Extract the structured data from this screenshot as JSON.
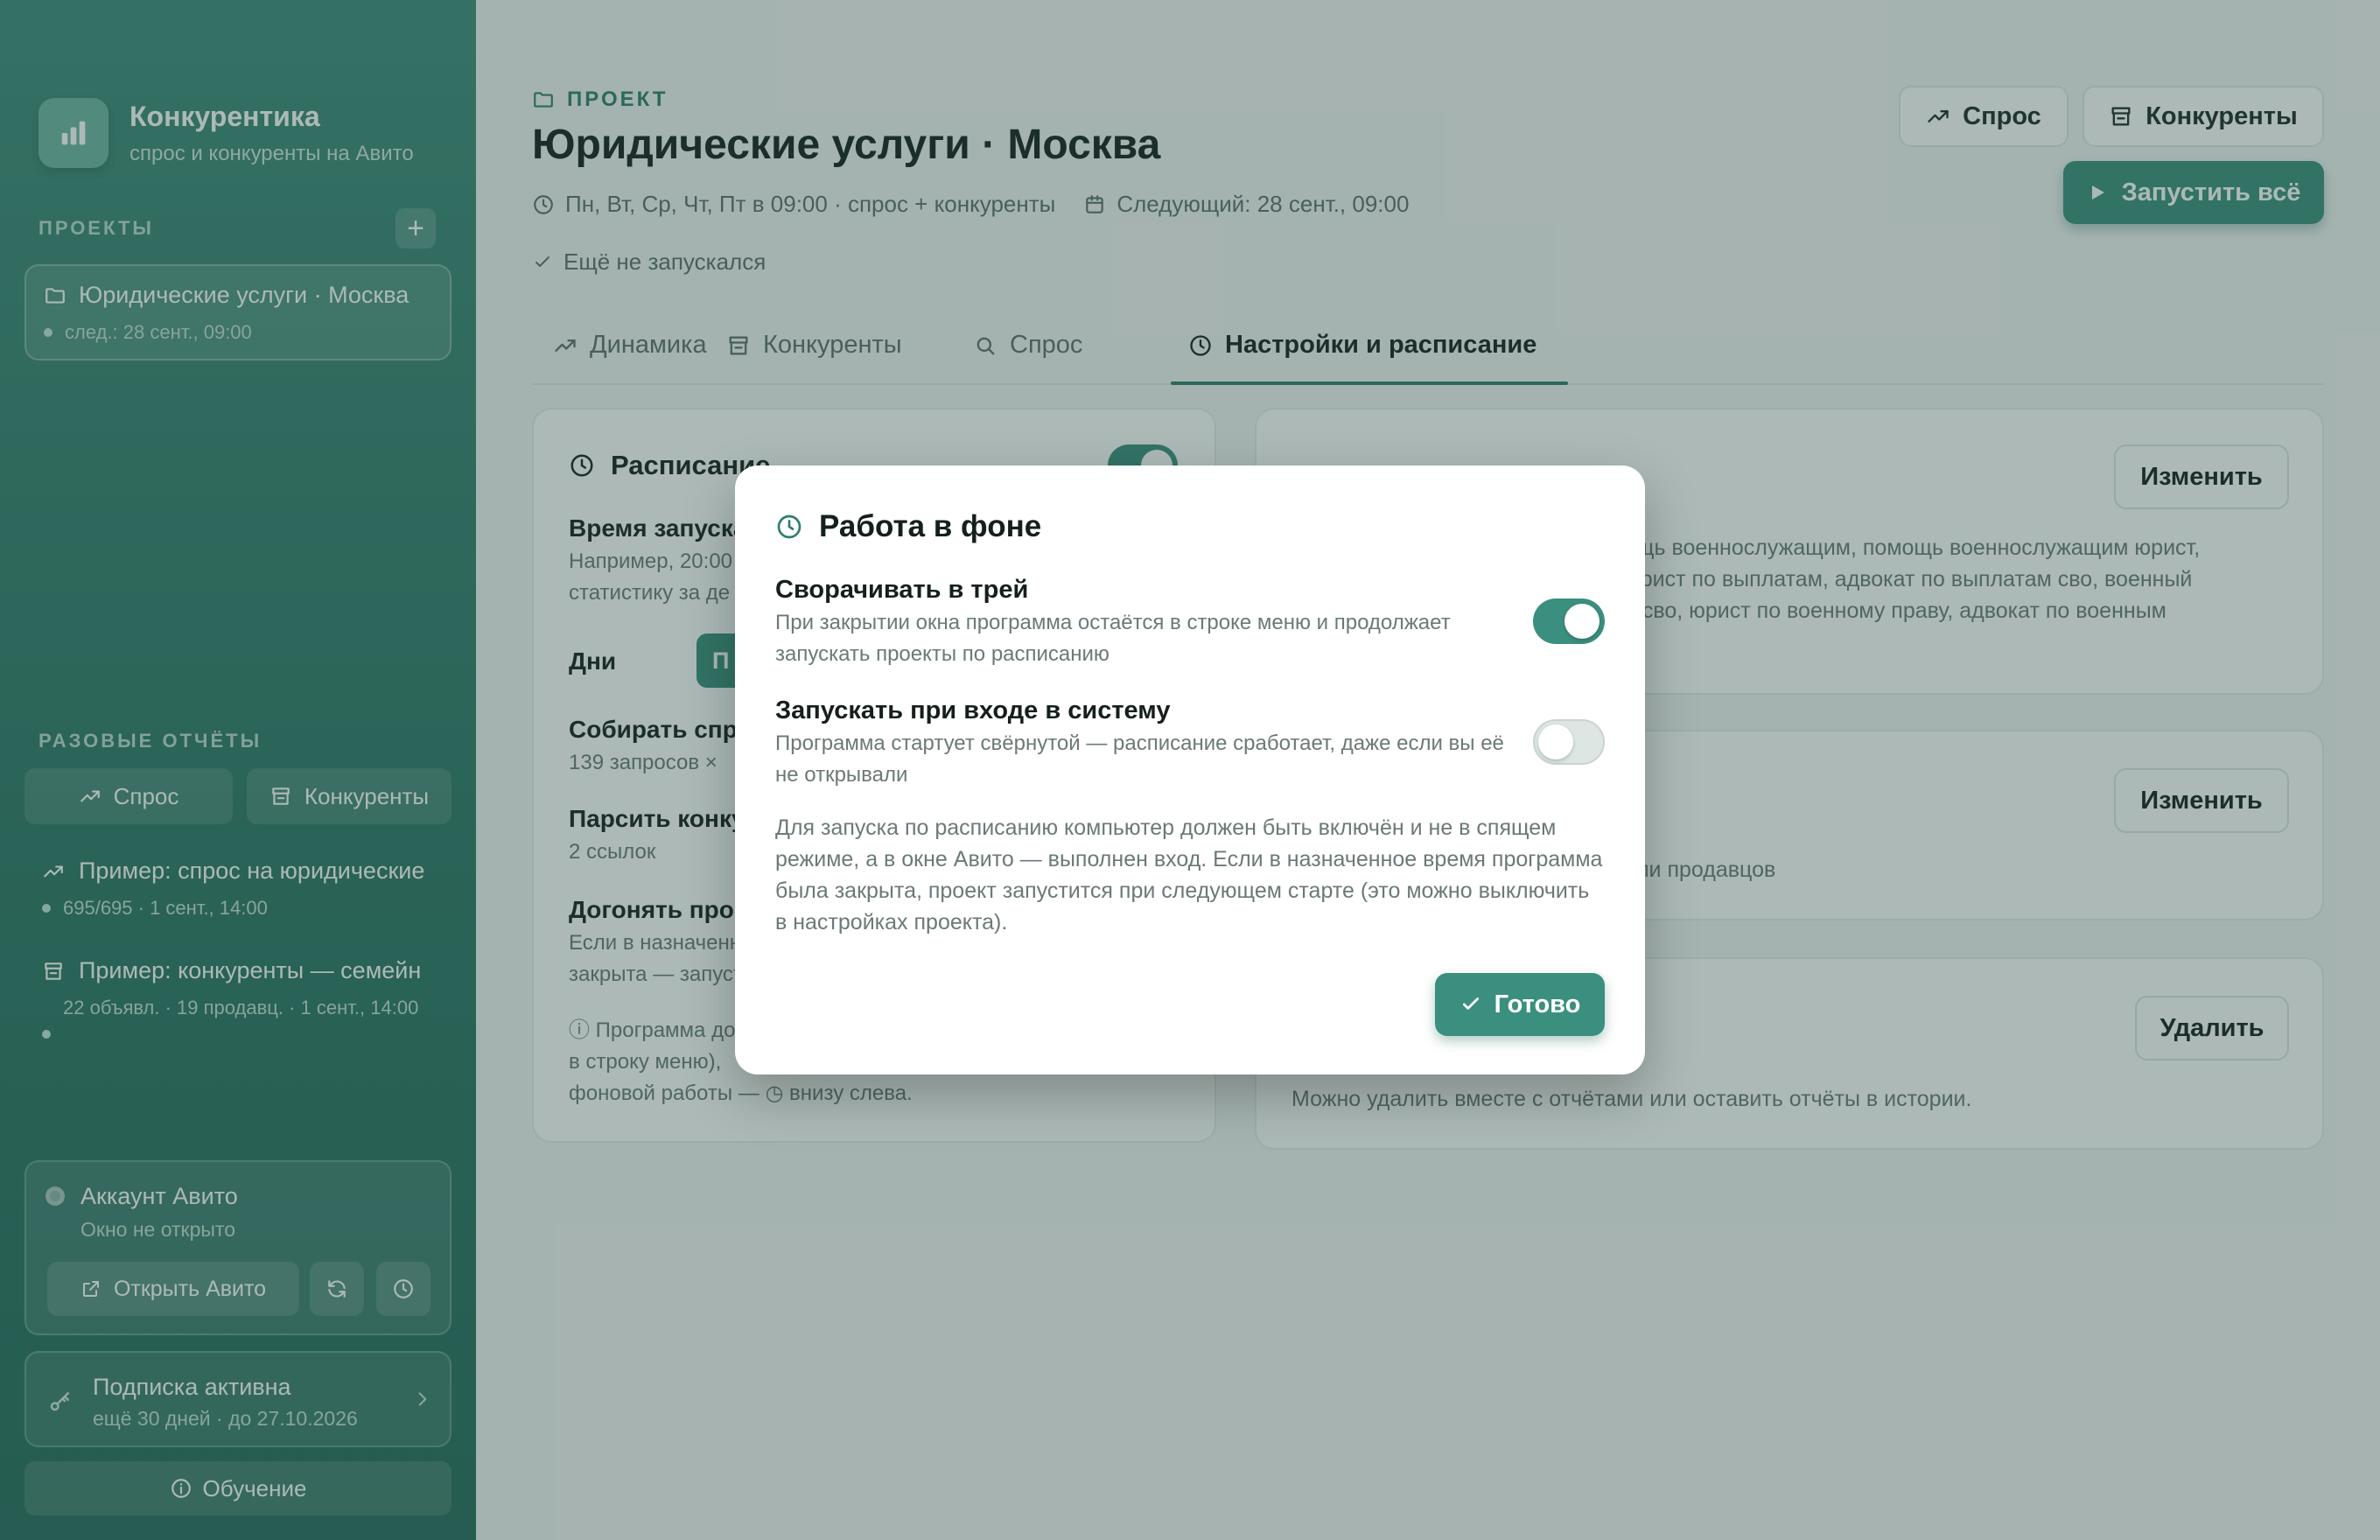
{
  "sidebar": {
    "brand_name": "Конкурентика",
    "brand_sub": "спрос и конкуренты на Авито",
    "projects_label": "ПРОЕКТЫ",
    "add_label": "+",
    "project": {
      "title": "Юридические услуги · Москва",
      "next": "след.: 28 сент., 09:00"
    },
    "reports_label": "РАЗОВЫЕ ОТЧЁТЫ",
    "report_buttons": [
      "Спрос",
      "Конкуренты"
    ],
    "reports": [
      {
        "title": "Пример: спрос на юридические",
        "sub": "695/695 · 1 сент., 14:00"
      },
      {
        "title": "Пример: конкуренты — семейн",
        "sub": "22 объявл. · 19 продавц. · 1 сент., 14:00"
      }
    ],
    "account": {
      "title": "Аккаунт Авито",
      "status": "Окно не открыто",
      "open_button": "Открыть Авито"
    },
    "subscription": {
      "title": "Подписка активна",
      "sub": "ещё 30 дней · до 27.10.2026"
    },
    "learn_button": "Обучение"
  },
  "header": {
    "kicker": "ПРОЕКТ",
    "title": "Юридические услуги · Москва",
    "schedule": "Пн, Вт, Ср, Чт, Пт в 09:00 · спрос + конкуренты",
    "next": "Следующий: 28 сент., 09:00",
    "status": "Ещё не запускался",
    "btn_demand": "Спрос",
    "btn_competitors": "Конкуренты",
    "btn_run_all": "Запустить всё"
  },
  "tabs": [
    "Динамика",
    "Конкуренты",
    "Спрос",
    "Настройки и расписание"
  ],
  "schedule_card": {
    "title": "Расписание",
    "time_label": "Время запуска",
    "time_hint_1": "Например, 20:00",
    "time_hint_2": "статистику за де",
    "days_label": "Дни",
    "day_chip": "П",
    "collect_label": "Собирать спрос",
    "collect_sub": "139 запросов ×",
    "parse_label": "Парсить конкурентов",
    "parse_sub": "2 ссылок",
    "catchup_label": "Догонять пропущенные",
    "catchup_text_1": "Если в назначенное",
    "catchup_text_2": "закрыта — запустится",
    "info_1": "ⓘ Программа должна",
    "info_2": "в строку меню),",
    "info_3": "фоновой работы — ◷ внизу слева."
  },
  "right_cards": {
    "keywords_text_1": "ощь военнослужащим, помощь военнослужащим юрист,",
    "keywords_text_2": "юрист по выплатам, адвокат по выплатам сво, военный",
    "keywords_text_3": "о сво, юрист по военному праву, адвокат по военным",
    "sellers_text": "или продавцов",
    "delete_text": "Можно удалить вместе с отчётами или оставить отчёты в истории.",
    "edit_button": "Изменить",
    "delete_button": "Удалить"
  },
  "modal": {
    "title": "Работа в фоне",
    "opt1_title": "Сворачивать в трей",
    "opt1_text": "При закрытии окна программа остаётся в строке меню и продолжает запускать проекты по расписанию",
    "opt1_on": true,
    "opt2_title": "Запускать при входе в систему",
    "opt2_text": "Программа стартует свёрнутой — расписание сработает, даже если вы её не открывали",
    "opt2_on": false,
    "note": "Для запуска по расписанию компьютер должен быть включён и не в спящем режиме, а в окне Авито — выполнен вход. Если в назначенное время программа была закрыта, проект запустится при следующем старте (это можно выключить в настройках проекта).",
    "done_button": "Готово"
  },
  "colors": {
    "accent": "#3b8f7e",
    "sidebar": "#2e7566"
  }
}
